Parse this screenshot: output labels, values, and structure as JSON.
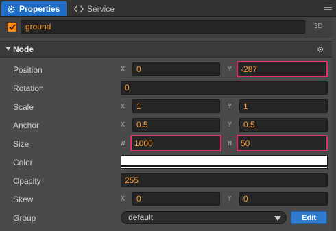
{
  "tabs": {
    "properties": "Properties",
    "service": "Service"
  },
  "node_header": {
    "active": true,
    "name": "ground",
    "mode_label": "3D"
  },
  "section": {
    "title": "Node"
  },
  "properties": {
    "position": {
      "label": "Position",
      "x_axis": "X",
      "y_axis": "Y",
      "x": "0",
      "y": "-287"
    },
    "rotation": {
      "label": "Rotation",
      "value": "0"
    },
    "scale": {
      "label": "Scale",
      "x_axis": "X",
      "y_axis": "Y",
      "x": "1",
      "y": "1"
    },
    "anchor": {
      "label": "Anchor",
      "x_axis": "X",
      "y_axis": "Y",
      "x": "0.5",
      "y": "0.5"
    },
    "size": {
      "label": "Size",
      "w_axis": "W",
      "h_axis": "H",
      "w": "1000",
      "h": "50"
    },
    "color": {
      "label": "Color",
      "value": "#ffffff"
    },
    "opacity": {
      "label": "Opacity",
      "value": "255"
    },
    "skew": {
      "label": "Skew",
      "x_axis": "X",
      "y_axis": "Y",
      "x": "0",
      "y": "0"
    },
    "group": {
      "label": "Group",
      "selected": "default",
      "edit_label": "Edit"
    }
  },
  "colors": {
    "accent": "#1e6ec8",
    "value_text": "#ff9a2e",
    "highlight": "#e0336a",
    "checkbox": "#ff8a17"
  },
  "icons": {
    "properties_tab": "gear-icon",
    "service_tab": "code-brackets-icon",
    "panel_menu": "menu-icon",
    "section_toggle": "triangle-down-icon",
    "section_settings": "gear-icon"
  }
}
